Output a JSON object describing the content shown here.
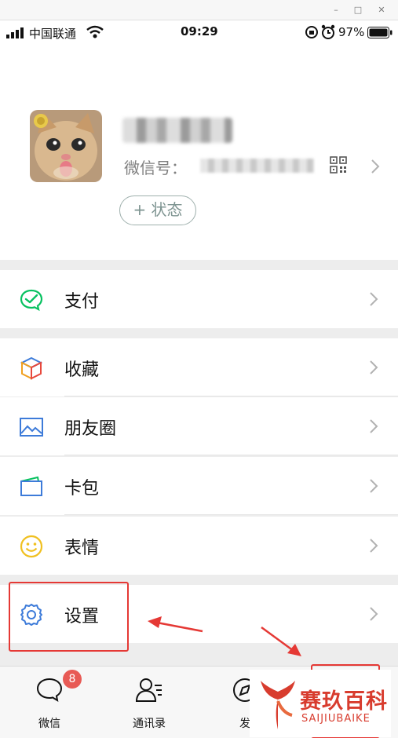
{
  "window": {
    "minimize": "–",
    "maximize": "□",
    "close": "✕"
  },
  "status_bar": {
    "carrier": "中国联通",
    "time": "09:29",
    "battery_percent": "97%"
  },
  "profile": {
    "wechat_id_label": "微信号：",
    "status_button": "+ 状态"
  },
  "menu": {
    "pay": "支付",
    "favorites": "收藏",
    "moments": "朋友圈",
    "cards": "卡包",
    "stickers": "表情",
    "settings": "设置"
  },
  "tabbar": {
    "chats": "微信",
    "chats_badge": "8",
    "contacts": "通讯录",
    "discover": "发"
  },
  "watermark": {
    "title": "赛玖百科",
    "subtitle": "SAIJIUBAIKE"
  },
  "colors": {
    "wechat_green": "#07c160",
    "annotation_red": "#e53935",
    "badge_red": "#e85a55",
    "settings_blue": "#3d7bd9"
  }
}
